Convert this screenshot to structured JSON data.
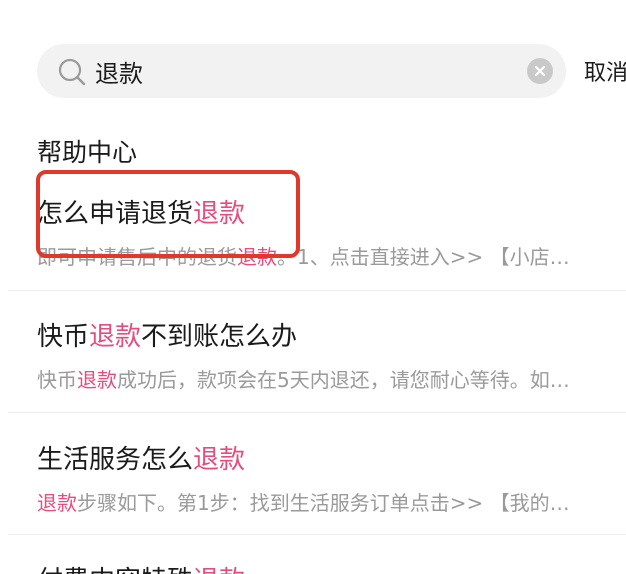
{
  "search": {
    "query": "退款",
    "cancel_label": "取消"
  },
  "section": {
    "title": "帮助中心"
  },
  "results": [
    {
      "title_pre": "怎么申请退货",
      "title_hl": "退款",
      "title_post": "",
      "snippet_pre": "即可申请售后中的退货",
      "snippet_hl": "退款",
      "snippet_post": "。1、点击直接进入>> 【小店…"
    },
    {
      "title_pre": "快币",
      "title_hl": "退款",
      "title_post": "不到账怎么办",
      "snippet_pre": "快币",
      "snippet_hl": "退款",
      "snippet_post": "成功后，款项会在5天内退还，请您耐心等待。如…"
    },
    {
      "title_pre": "生活服务怎么",
      "title_hl": "退款",
      "title_post": "",
      "snippet_pre": "",
      "snippet_hl": "退款",
      "snippet_post": "步骤如下。第1步：找到生活服务订单点击>> 【我的…"
    },
    {
      "title_pre": "付费内容特殊",
      "title_hl": "退款",
      "title_post": ""
    }
  ],
  "colors": {
    "highlight": "#e54d7d",
    "annotation": "#e0392b",
    "snippet": "#9a9a9a",
    "search_bg": "#f2f2f2"
  },
  "icons": {
    "search": "search-icon",
    "clear": "clear-icon"
  }
}
